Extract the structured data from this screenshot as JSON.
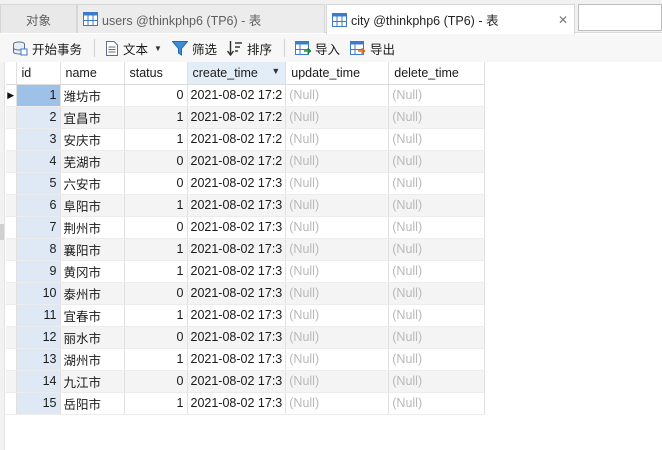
{
  "tabs": [
    {
      "label": "对象"
    },
    {
      "label": "users @thinkphp6 (TP6) - 表"
    },
    {
      "label": "city @thinkphp6 (TP6) - 表",
      "close": "✕"
    }
  ],
  "toolbar": {
    "begin_transaction": "开始事务",
    "text": "文本",
    "filter": "筛选",
    "sort": "排序",
    "import": "导入",
    "export": "导出"
  },
  "grid": {
    "columns": [
      "id",
      "name",
      "status",
      "create_time",
      "update_time",
      "delete_time"
    ],
    "sorted_column": "create_time",
    "current_row_marker": "▶",
    "rows": [
      {
        "id": "1",
        "name": "潍坊市",
        "status": "0",
        "create_time": "2021-08-02 17:2",
        "update_time": "(Null)",
        "delete_time": "(Null)"
      },
      {
        "id": "2",
        "name": "宜昌市",
        "status": "1",
        "create_time": "2021-08-02 17:2",
        "update_time": "(Null)",
        "delete_time": "(Null)"
      },
      {
        "id": "3",
        "name": "安庆市",
        "status": "1",
        "create_time": "2021-08-02 17:2",
        "update_time": "(Null)",
        "delete_time": "(Null)"
      },
      {
        "id": "4",
        "name": "芜湖市",
        "status": "0",
        "create_time": "2021-08-02 17:2",
        "update_time": "(Null)",
        "delete_time": "(Null)"
      },
      {
        "id": "5",
        "name": "六安市",
        "status": "0",
        "create_time": "2021-08-02 17:3",
        "update_time": "(Null)",
        "delete_time": "(Null)"
      },
      {
        "id": "6",
        "name": "阜阳市",
        "status": "1",
        "create_time": "2021-08-02 17:3",
        "update_time": "(Null)",
        "delete_time": "(Null)"
      },
      {
        "id": "7",
        "name": "荆州市",
        "status": "0",
        "create_time": "2021-08-02 17:3",
        "update_time": "(Null)",
        "delete_time": "(Null)"
      },
      {
        "id": "8",
        "name": "襄阳市",
        "status": "1",
        "create_time": "2021-08-02 17:3",
        "update_time": "(Null)",
        "delete_time": "(Null)"
      },
      {
        "id": "9",
        "name": "黄冈市",
        "status": "1",
        "create_time": "2021-08-02 17:3",
        "update_time": "(Null)",
        "delete_time": "(Null)"
      },
      {
        "id": "10",
        "name": "泰州市",
        "status": "0",
        "create_time": "2021-08-02 17:3",
        "update_time": "(Null)",
        "delete_time": "(Null)"
      },
      {
        "id": "11",
        "name": "宜春市",
        "status": "1",
        "create_time": "2021-08-02 17:3",
        "update_time": "(Null)",
        "delete_time": "(Null)"
      },
      {
        "id": "12",
        "name": "丽水市",
        "status": "0",
        "create_time": "2021-08-02 17:3",
        "update_time": "(Null)",
        "delete_time": "(Null)"
      },
      {
        "id": "13",
        "name": "湖州市",
        "status": "1",
        "create_time": "2021-08-02 17:3",
        "update_time": "(Null)",
        "delete_time": "(Null)"
      },
      {
        "id": "14",
        "name": "九江市",
        "status": "0",
        "create_time": "2021-08-02 17:3",
        "update_time": "(Null)",
        "delete_time": "(Null)"
      },
      {
        "id": "15",
        "name": "岳阳市",
        "status": "1",
        "create_time": "2021-08-02 17:3",
        "update_time": "(Null)",
        "delete_time": "(Null)"
      }
    ]
  },
  "colors": {
    "accent": "#1e6fc4",
    "selected_id": "#9ec1e8",
    "id_column": "#dfe9f5",
    "null_text": "#b9b9b9"
  }
}
